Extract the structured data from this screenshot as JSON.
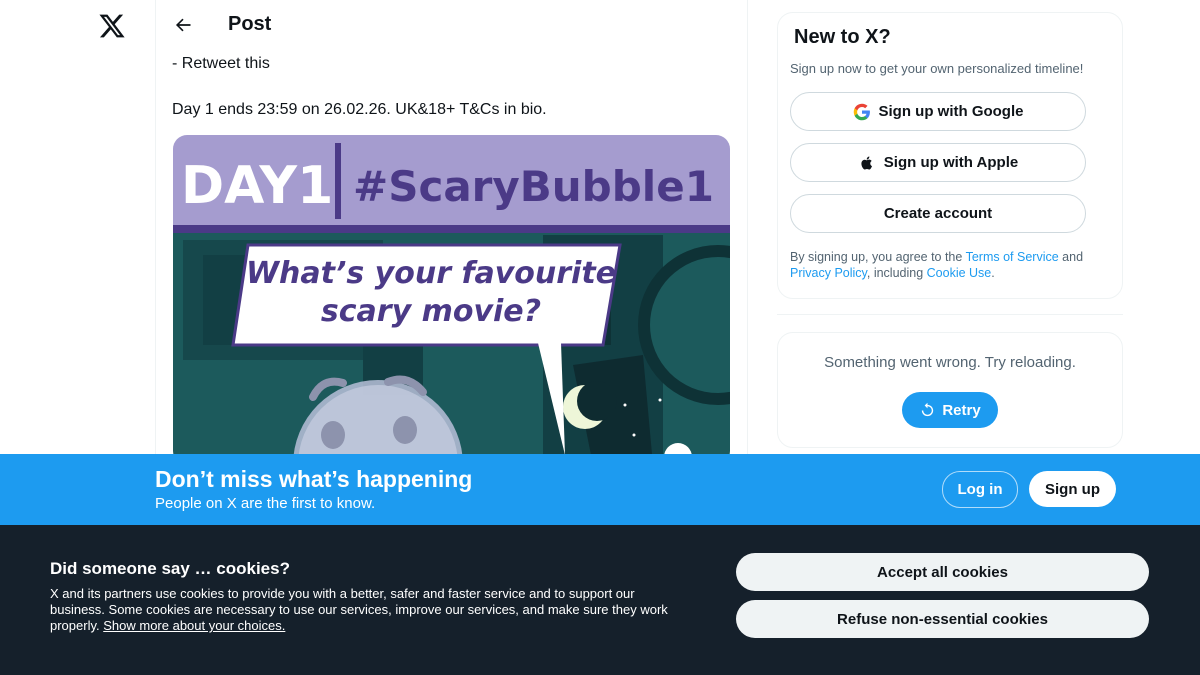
{
  "nav": {
    "logo_icon": "x-logo-icon"
  },
  "header": {
    "back_icon": "arrow-left-icon",
    "title": "Post"
  },
  "tweet": {
    "line1": "- Retweet this",
    "line2": "Day 1 ends 23:59 on 26.02.26. UK&18+ T&Cs in bio.",
    "media": {
      "banner_day": "DAY1",
      "banner_hashtag": "#ScaryBubble1",
      "bubble_line1": "What’s your favourite",
      "bubble_line2": "scary movie?",
      "colors": {
        "banner": "#a59ccf",
        "purple": "#4b3a87",
        "teal": "#1c5a5c",
        "dark_teal": "#123f44"
      }
    }
  },
  "sidebar": {
    "title": "New to X?",
    "subtitle": "Sign up now to get your own personalized timeline!",
    "google_label": "Sign up with Google",
    "apple_label": "Sign up with Apple",
    "create_label": "Create account",
    "legal_prefix": "By signing up, you agree to the ",
    "terms_link": "Terms of Service",
    "legal_and": " and ",
    "privacy_link": "Privacy Policy",
    "legal_including": ", including ",
    "cookie_link": "Cookie Use",
    "legal_end": ".",
    "error_msg": "Something went wrong. Try reloading.",
    "retry_label": "Retry"
  },
  "signup_bar": {
    "title": "Don’t miss what’s happening",
    "subtitle": "People on X are the first to know.",
    "login_label": "Log in",
    "signup_label": "Sign up",
    "color": "#1d9bf0"
  },
  "cookie_banner": {
    "title": "Did someone say … cookies?",
    "body": "X and its partners use cookies to provide you with a better, safer and faster service and to support our business. Some cookies are necessary to use our services, improve our services, and make sure they work properly. ",
    "link": "Show more about your choices.",
    "accept_label": "Accept all cookies",
    "refuse_label": "Refuse non-essential cookies",
    "background": "#15202b"
  }
}
